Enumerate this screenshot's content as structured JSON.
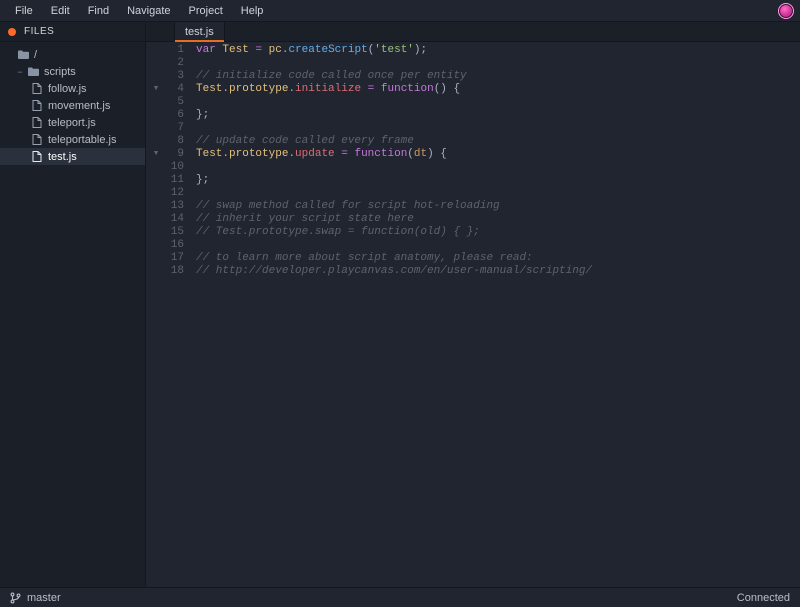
{
  "menubar": {
    "items": [
      "File",
      "Edit",
      "Find",
      "Navigate",
      "Project",
      "Help"
    ]
  },
  "sidebar": {
    "panel_title": "FILES",
    "root_label": "/",
    "folder": {
      "label": "scripts"
    },
    "files": [
      {
        "label": "follow.js"
      },
      {
        "label": "movement.js"
      },
      {
        "label": "teleport.js"
      },
      {
        "label": "teleportable.js"
      },
      {
        "label": "test.js",
        "selected": true
      }
    ]
  },
  "tabs": [
    {
      "label": "test.js",
      "active": true
    }
  ],
  "code": {
    "fold_rows": {
      "4": "▾",
      "9": "▾"
    },
    "lines": [
      {
        "n": 1,
        "t": [
          [
            "kw",
            "var"
          ],
          [
            "pn",
            " "
          ],
          [
            "decl",
            "Test"
          ],
          [
            "pn",
            " "
          ],
          [
            "op",
            "="
          ],
          [
            "pn",
            " "
          ],
          [
            "decl",
            "pc"
          ],
          [
            "pn",
            "."
          ],
          [
            "fn",
            "createScript"
          ],
          [
            "pn",
            "("
          ],
          [
            "str",
            "'test'"
          ],
          [
            "pn",
            ");"
          ]
        ]
      },
      {
        "n": 2,
        "t": []
      },
      {
        "n": 3,
        "t": [
          [
            "cmt",
            "// initialize code called once per entity"
          ]
        ]
      },
      {
        "n": 4,
        "t": [
          [
            "decl",
            "Test"
          ],
          [
            "pn",
            "."
          ],
          [
            "decl",
            "prototype"
          ],
          [
            "pn",
            "."
          ],
          [
            "prop",
            "initialize"
          ],
          [
            "pn",
            " "
          ],
          [
            "op",
            "="
          ],
          [
            "pn",
            " "
          ],
          [
            "func",
            "function"
          ],
          [
            "pn",
            "() {"
          ]
        ]
      },
      {
        "n": 5,
        "t": []
      },
      {
        "n": 6,
        "t": [
          [
            "pn",
            "};"
          ]
        ]
      },
      {
        "n": 7,
        "t": []
      },
      {
        "n": 8,
        "t": [
          [
            "cmt",
            "// update code called every frame"
          ]
        ]
      },
      {
        "n": 9,
        "t": [
          [
            "decl",
            "Test"
          ],
          [
            "pn",
            "."
          ],
          [
            "decl",
            "prototype"
          ],
          [
            "pn",
            "."
          ],
          [
            "prop",
            "update"
          ],
          [
            "pn",
            " "
          ],
          [
            "op",
            "="
          ],
          [
            "pn",
            " "
          ],
          [
            "func",
            "function"
          ],
          [
            "pn",
            "("
          ],
          [
            "param",
            "dt"
          ],
          [
            "pn",
            ") {"
          ]
        ]
      },
      {
        "n": 10,
        "t": []
      },
      {
        "n": 11,
        "t": [
          [
            "pn",
            "};"
          ]
        ]
      },
      {
        "n": 12,
        "t": []
      },
      {
        "n": 13,
        "t": [
          [
            "cmt",
            "// swap method called for script hot-reloading"
          ]
        ]
      },
      {
        "n": 14,
        "t": [
          [
            "cmt",
            "// inherit your script state here"
          ]
        ]
      },
      {
        "n": 15,
        "t": [
          [
            "cmt",
            "// Test.prototype.swap = function(old) { };"
          ]
        ]
      },
      {
        "n": 16,
        "t": []
      },
      {
        "n": 17,
        "t": [
          [
            "cmt",
            "// to learn more about script anatomy, please read:"
          ]
        ]
      },
      {
        "n": 18,
        "t": [
          [
            "cmt",
            "// http://developer.playcanvas.com/en/user-manual/scripting/"
          ]
        ]
      }
    ]
  },
  "statusbar": {
    "branch": "master",
    "connection": "Connected"
  }
}
